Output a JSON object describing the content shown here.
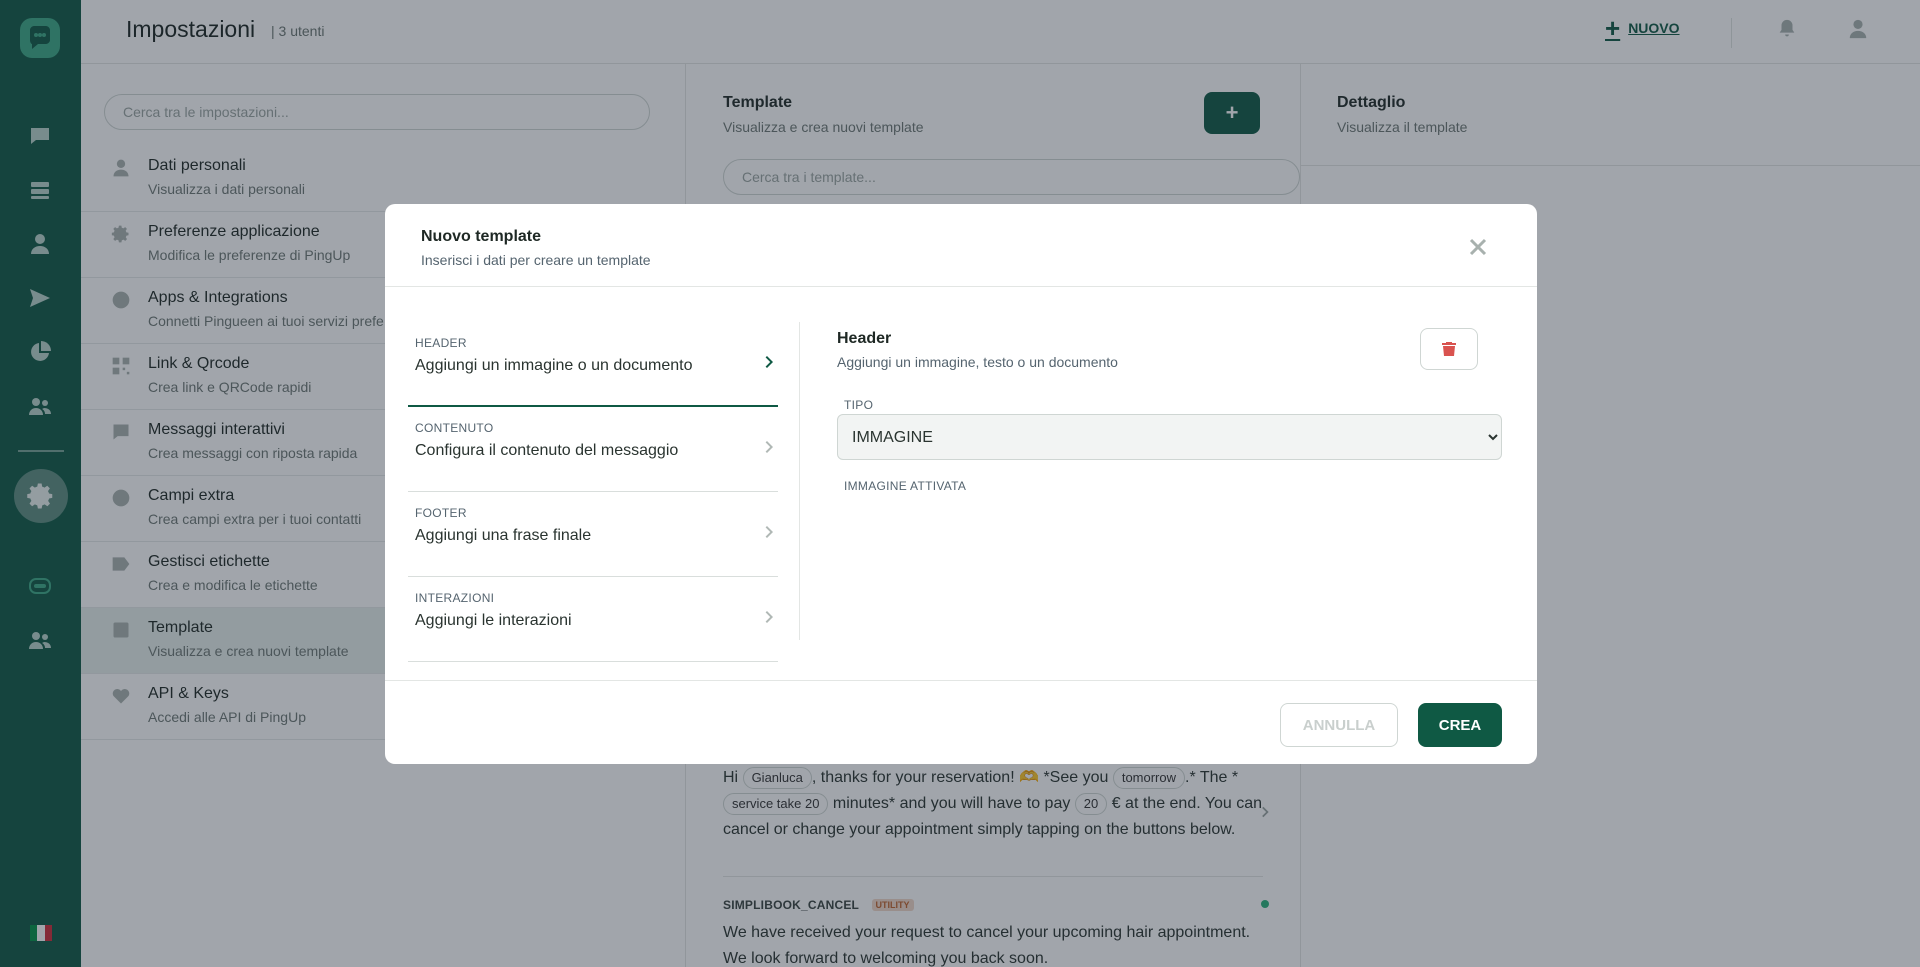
{
  "app": {
    "title": "Impostazioni",
    "user_count": "| 3 utenti",
    "new_label": "NUOVO",
    "accent_color": "#0f5944"
  },
  "rail": {
    "icons": [
      "chat-bubble-icon",
      "inbox-stack-icon",
      "user-icon",
      "send-icon",
      "pie-chart-icon",
      "team-icon",
      "settings-icon",
      "chatbot-icon",
      "team-icon"
    ],
    "language": "it"
  },
  "settings": {
    "search_placeholder": "Cerca tra le impostazioni...",
    "items": [
      {
        "label": "Dati personali",
        "desc": "Visualizza i dati personali",
        "icon": "user-icon"
      },
      {
        "label": "Preferenze applicazione",
        "desc": "Modifica le preferenze di PingUp",
        "icon": "gear-icon"
      },
      {
        "label": "Apps & Integrations",
        "desc": "Connetti Pingueen ai tuoi servizi prefe",
        "icon": "integrations-icon"
      },
      {
        "label": "Link & Qrcode",
        "desc": "Crea link e QRCode rapidi",
        "icon": "qrcode-icon"
      },
      {
        "label": "Messaggi interattivi",
        "desc": "Crea messaggi con riposta rapida",
        "icon": "message-icon"
      },
      {
        "label": "Campi extra",
        "desc": "Crea campi extra per i tuoi contatti",
        "icon": "info-icon"
      },
      {
        "label": "Gestisci etichette",
        "desc": "Crea e modifica le etichette",
        "icon": "tag-icon"
      },
      {
        "label": "Template",
        "desc": "Visualizza e crea nuovi template",
        "icon": "template-icon"
      },
      {
        "label": "API & Keys",
        "desc": "Accedi alle API di PingUp",
        "icon": "heart-icon"
      }
    ]
  },
  "templates": {
    "title": "Template",
    "subtitle": "Visualizza e crea nuovi template",
    "add_label": "+",
    "search_placeholder": "Cerca tra i template...",
    "card1": {
      "t1": "Hi ",
      "chip1": "Gianluca",
      "t2": ", thanks for your reservation! 🫶 *See you ",
      "chip2": "tomorrow",
      "t3": ".* The *",
      "chip3": "service take 20",
      "t4": " minutes* and you will have to pay ",
      "chip4": "20",
      "t5": " € at the end. You can cancel or change your appointment simply tapping on the buttons below."
    },
    "card2": {
      "name": "SIMPLIBOOK_CANCEL",
      "badge": "UTILITY",
      "body": "We have received your request to cancel your upcoming hair appointment. We look forward to welcoming you back soon."
    }
  },
  "detail": {
    "title": "Dettaglio",
    "subtitle": "Visualizza il template"
  },
  "modal": {
    "title": "Nuovo template",
    "subtitle": "Inserisci i dati per creare un template",
    "steps": [
      {
        "label": "HEADER",
        "text": "Aggiungi un immagine o un documento"
      },
      {
        "label": "CONTENUTO",
        "text": "Configura il contenuto del messaggio"
      },
      {
        "label": "FOOTER",
        "text": "Aggiungi una frase finale"
      },
      {
        "label": "INTERAZIONI",
        "text": "Aggiungi le interazioni"
      }
    ],
    "panel": {
      "title": "Header",
      "subtitle": "Aggiungi un immagine, testo o un documento",
      "type_label": "TIPO",
      "type_value": "IMMAGINE",
      "status_label": "IMMAGINE ATTIVATA"
    },
    "cancel_label": "ANNULLA",
    "create_label": "CREA"
  }
}
